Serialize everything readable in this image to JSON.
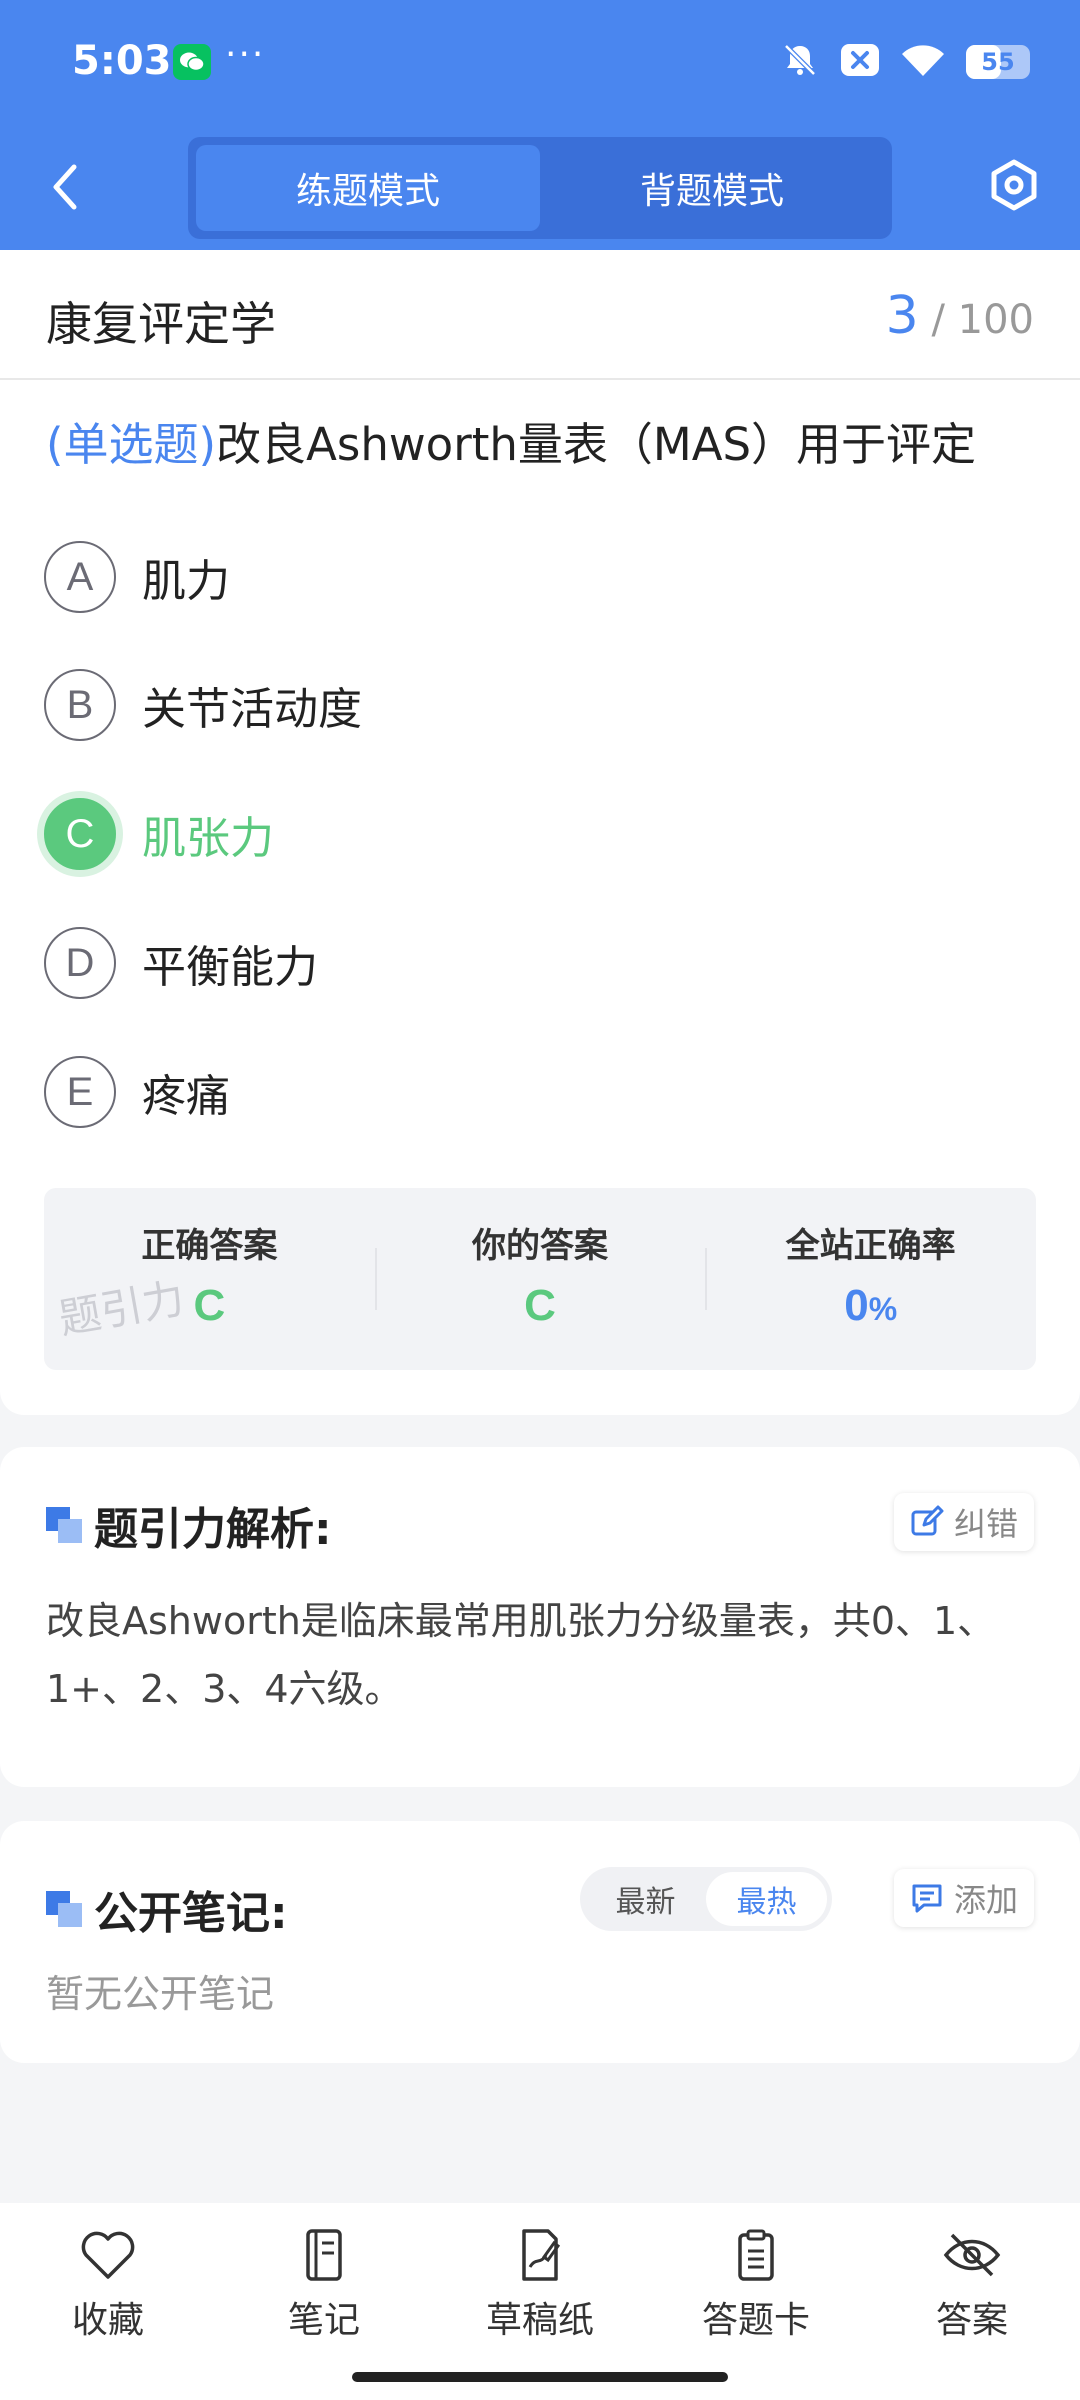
{
  "status_bar": {
    "time": "5:03",
    "more": "···",
    "battery_level": "55",
    "battery_fraction": 0.55
  },
  "nav": {
    "back_icon": "chevron-left-icon",
    "modes": [
      {
        "label": "练题模式",
        "active": true
      },
      {
        "label": "背题模式",
        "active": false
      }
    ],
    "settings_icon": "hexagon-gear-icon"
  },
  "subject": {
    "title": "康复评定学",
    "current": "3",
    "separator": "/",
    "total": "100"
  },
  "question": {
    "type": "(单选题)",
    "text": "改良Ashworth量表（MAS）用于评定",
    "options": [
      {
        "letter": "A",
        "text": "肌力"
      },
      {
        "letter": "B",
        "text": "关节活动度"
      },
      {
        "letter": "C",
        "text": "肌张力"
      },
      {
        "letter": "D",
        "text": "平衡能力"
      },
      {
        "letter": "E",
        "text": "疼痛"
      }
    ]
  },
  "answer_summary": {
    "correct_label": "正确答案",
    "correct_value": "C",
    "yours_label": "你的答案",
    "yours_value": "C",
    "rate_label": "全站正确率",
    "rate_value": "0",
    "rate_unit": "%",
    "watermark": "题引力"
  },
  "analysis": {
    "title": "题引力解析:",
    "correct_button": "纠错",
    "text": "改良Ashworth是临床最常用肌张力分级量表，共0、1、1+、2、3、4六级。"
  },
  "notes": {
    "title": "公开笔记:",
    "sort_newest": "最新",
    "sort_hottest": "最热",
    "add_button": "添加",
    "empty_text": "暂无公开笔记"
  },
  "bottom_tools": [
    {
      "label": "收藏",
      "icon": "heart-icon"
    },
    {
      "label": "笔记",
      "icon": "notebook-icon"
    },
    {
      "label": "草稿纸",
      "icon": "draft-paper-icon"
    },
    {
      "label": "答题卡",
      "icon": "answer-card-icon"
    },
    {
      "label": "答案",
      "icon": "eye-off-icon"
    }
  ],
  "colors": {
    "primary": "#4a86ef",
    "correct": "#5bc97e"
  }
}
